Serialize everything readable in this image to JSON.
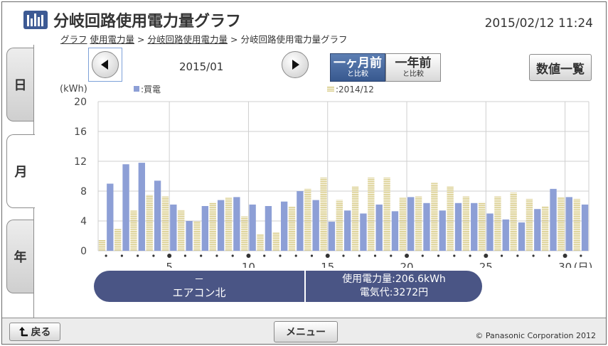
{
  "header": {
    "title": "分岐回路使用電力量グラフ",
    "datetime": "2015/02/12  11:24",
    "breadcrumb": {
      "item1": "グラフ",
      "item2": "使用電力量",
      "sep": ">",
      "item3": "分岐回路使用電力量",
      "item4": "分岐回路使用電力量グラフ"
    }
  },
  "tabs": [
    {
      "label": "日",
      "active": false
    },
    {
      "label": "月",
      "active": true
    },
    {
      "label": "年",
      "active": false
    }
  ],
  "nav": {
    "month": "2015/01",
    "compare_month_line1": "一ヶ月前",
    "compare_month_line2": "と比較",
    "compare_year_line1": "一年前",
    "compare_year_line2": "と比較",
    "list_button": "数値一覧"
  },
  "icons": {
    "prev": "triangle-left-icon",
    "next": "triangle-right-icon",
    "back": "return-arrow-icon",
    "title": "bar-chart-icon"
  },
  "colors": {
    "current": "#8d9fd6",
    "previous": "#d7ca84",
    "summary_bg": "#4a5585",
    "selected_button": "#38598f"
  },
  "chart_data": {
    "type": "bar",
    "ylabel": "(kWh)",
    "ylim": [
      0,
      20
    ],
    "yticks": [
      0,
      4,
      8,
      12,
      16,
      20
    ],
    "x": [
      1,
      2,
      3,
      4,
      5,
      6,
      7,
      8,
      9,
      10,
      11,
      12,
      13,
      14,
      15,
      16,
      17,
      18,
      19,
      20,
      21,
      22,
      23,
      24,
      25,
      26,
      27,
      28,
      29,
      30,
      31
    ],
    "xtick_labels": [
      "5",
      "10",
      "15",
      "20",
      "25",
      "30",
      "(日)"
    ],
    "xtick_positions": [
      5,
      10,
      15,
      20,
      25,
      30
    ],
    "series": [
      {
        "name": "■:買電",
        "values": [
          9.0,
          11.6,
          11.8,
          9.4,
          6.2,
          4.0,
          6.0,
          6.8,
          7.2,
          6.2,
          6.0,
          6.6,
          8.0,
          6.8,
          3.9,
          5.4,
          5.0,
          6.2,
          5.3,
          7.2,
          6.4,
          5.4,
          6.4,
          6.4,
          5.0,
          4.2,
          3.8,
          5.6,
          8.3,
          7.2,
          6.2
        ]
      },
      {
        "name": "■:2014/12",
        "values": [
          1.5,
          3.0,
          5.4,
          7.5,
          7.3,
          5.5,
          4.0,
          6.5,
          7.1,
          4.6,
          2.2,
          2.5,
          5.9,
          8.3,
          9.8,
          6.8,
          8.6,
          9.8,
          9.8,
          7.1,
          7.3,
          9.1,
          8.6,
          7.3,
          6.5,
          7.3,
          7.8,
          7.0,
          6.0,
          7.2,
          7.0
        ]
      }
    ]
  },
  "summary": {
    "left_dash": "－",
    "circuit_name": "エアコン北",
    "usage": "使用電力量:206.6kWh",
    "cost": "電気代:3272円"
  },
  "footer": {
    "back": "戻る",
    "menu": "メニュー",
    "copyright": "© Panasonic Corporation 2012"
  }
}
